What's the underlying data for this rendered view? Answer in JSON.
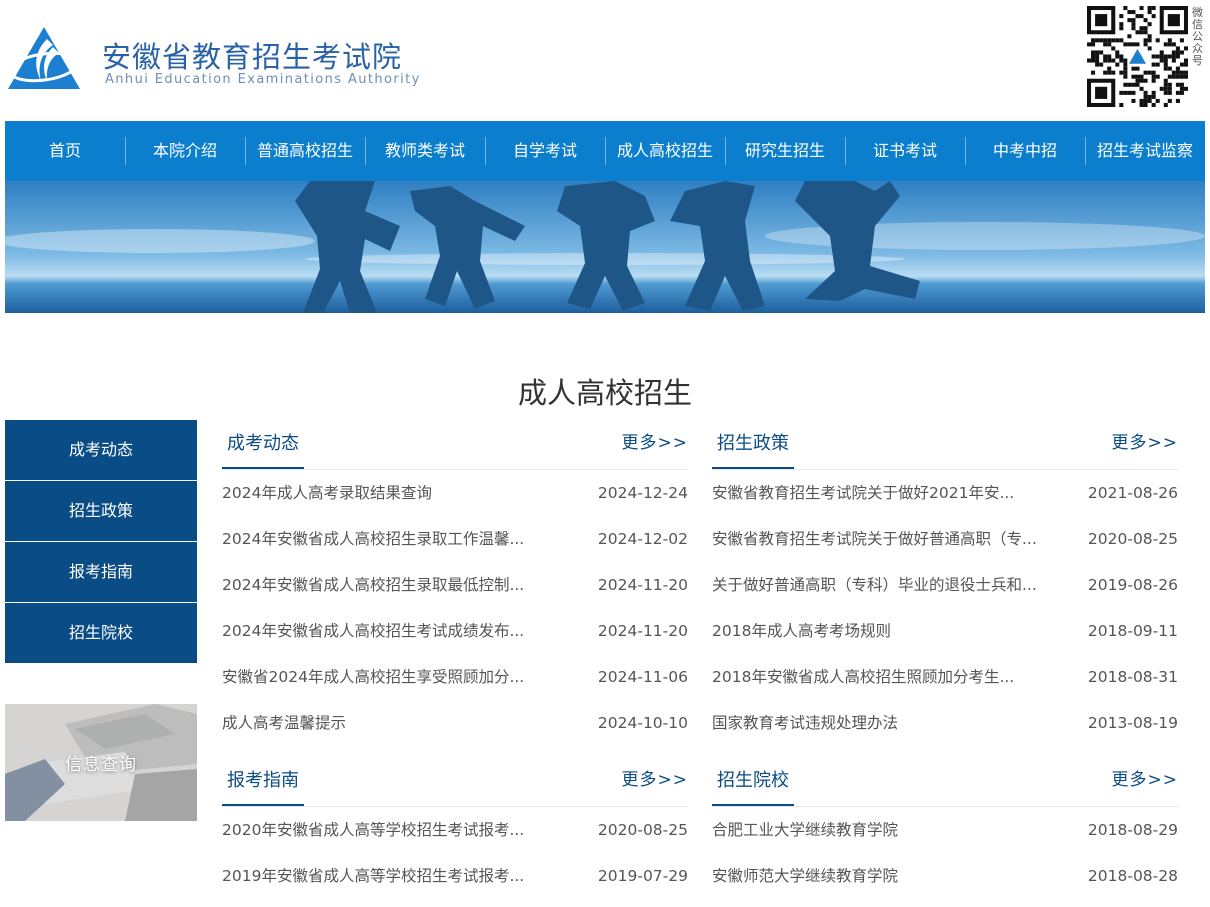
{
  "header": {
    "site_name": "安徽省教育招生考试院",
    "site_name_en": "Anhui Education Examinations Authority",
    "qr_label": "微信公众号",
    "brand_color": "#2a62a8"
  },
  "nav": {
    "items": [
      {
        "label": "首页"
      },
      {
        "label": "本院介绍"
      },
      {
        "label": "普通高校招生"
      },
      {
        "label": "教师类考试"
      },
      {
        "label": "自学考试"
      },
      {
        "label": "成人高校招生"
      },
      {
        "label": "研究生招生"
      },
      {
        "label": "证书考试"
      },
      {
        "label": "中考中招"
      },
      {
        "label": "招生考试监察"
      }
    ],
    "color": "#0b7fcd"
  },
  "page": {
    "title": "成人高校招生"
  },
  "sidebar": {
    "items": [
      {
        "label": "成考动态"
      },
      {
        "label": "招生政策"
      },
      {
        "label": "报考指南"
      },
      {
        "label": "招生院校"
      }
    ],
    "info_card_label": "信息查询",
    "color": "#0a4c86"
  },
  "panels": {
    "news": {
      "title": "成考动态",
      "more": "更多>>",
      "rows": [
        {
          "title": "2024年成人高考录取结果查询",
          "date": "2024-12-24"
        },
        {
          "title": "2024年安徽省成人高校招生录取工作温馨...",
          "date": "2024-12-02"
        },
        {
          "title": "2024年安徽省成人高校招生录取最低控制...",
          "date": "2024-11-20"
        },
        {
          "title": "2024年安徽省成人高校招生考试成绩发布...",
          "date": "2024-11-20"
        },
        {
          "title": "安徽省2024年成人高校招生享受照顾加分...",
          "date": "2024-11-06"
        },
        {
          "title": "成人高考温馨提示",
          "date": "2024-10-10"
        }
      ]
    },
    "policy": {
      "title": "招生政策",
      "more": "更多>>",
      "rows": [
        {
          "title": "安徽省教育招生考试院关于做好2021年安...",
          "date": "2021-08-26"
        },
        {
          "title": "安徽省教育招生考试院关于做好普通高职（专...",
          "date": "2020-08-25"
        },
        {
          "title": "关于做好普通高职（专科）毕业的退役士兵和...",
          "date": "2019-08-26"
        },
        {
          "title": "2018年成人高考考场规则",
          "date": "2018-09-11"
        },
        {
          "title": "2018年安徽省成人高校招生照顾加分考生...",
          "date": "2018-08-31"
        },
        {
          "title": "国家教育考试违规处理办法",
          "date": "2013-08-19"
        }
      ]
    },
    "guide": {
      "title": "报考指南",
      "more": "更多>>",
      "rows": [
        {
          "title": "2020年安徽省成人高等学校招生考试报考...",
          "date": "2020-08-25"
        },
        {
          "title": "2019年安徽省成人高等学校招生考试报考...",
          "date": "2019-07-29"
        }
      ]
    },
    "schools": {
      "title": "招生院校",
      "more": "更多>>",
      "rows": [
        {
          "title": "合肥工业大学继续教育学院",
          "date": "2018-08-29"
        },
        {
          "title": "安徽师范大学继续教育学院",
          "date": "2018-08-28"
        }
      ]
    }
  }
}
